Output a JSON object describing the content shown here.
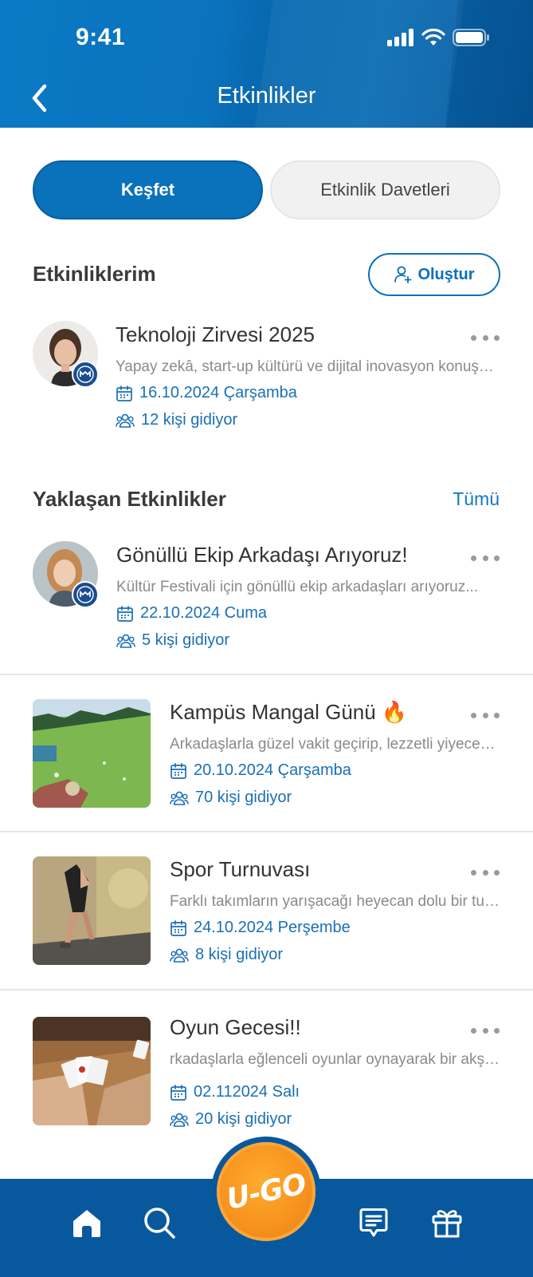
{
  "status_bar": {
    "time": "9:41"
  },
  "header": {
    "title": "Etkinlikler"
  },
  "tabs": [
    {
      "label": "Keşfet",
      "active": true
    },
    {
      "label": "Etkinlik Davetleri",
      "active": false
    }
  ],
  "my_events": {
    "title": "Etkinliklerim",
    "create_label": "Oluştur",
    "items": [
      {
        "title": "Teknoloji Zirvesi 2025",
        "desc": "Yapay zekâ, start-up kültürü ve dijital inovasyon konuşulacak",
        "date": "16.10.2024 Çarşamba",
        "attendees": "12 kişi gidiyor"
      }
    ]
  },
  "upcoming": {
    "title": "Yaklaşan Etkinlikler",
    "see_all": "Tümü",
    "items": [
      {
        "title": "Gönüllü Ekip Arkadaşı Arıyoruz!",
        "desc": "Kültür Festivali için gönüllü ekip arkadaşları arıyoruz...",
        "date": "22.10.2024 Cuma",
        "attendees": "5 kişi gidiyor"
      },
      {
        "title": "Kampüs Mangal Günü 🔥",
        "desc": "Arkadaşlarla güzel vakit geçirip, lezzetli yiyecekler",
        "date": "20.10.2024 Çarşamba",
        "attendees": "70 kişi gidiyor"
      },
      {
        "title": "Spor Turnuvası",
        "desc": "Farklı takımların yarışacağı heyecan dolu bir turnuva",
        "date": "24.10.2024 Perşembe",
        "attendees": "8 kişi gidiyor"
      },
      {
        "title": "Oyun Gecesi!!",
        "desc": "rkadaşlarla eğlenceli oyunlar oynayarak bir akşam",
        "date": "02.112024 Salı",
        "attendees": "20 kişi gidiyor"
      }
    ]
  },
  "bottom_nav": {
    "items": [
      "home-icon",
      "search-icon",
      "ugo-button",
      "chat-icon",
      "gift-icon"
    ],
    "fab_label": "U-GO"
  },
  "colors": {
    "primary": "#0a71bb",
    "accent_orange": "#f7931e",
    "nav_bg": "#08589e"
  }
}
